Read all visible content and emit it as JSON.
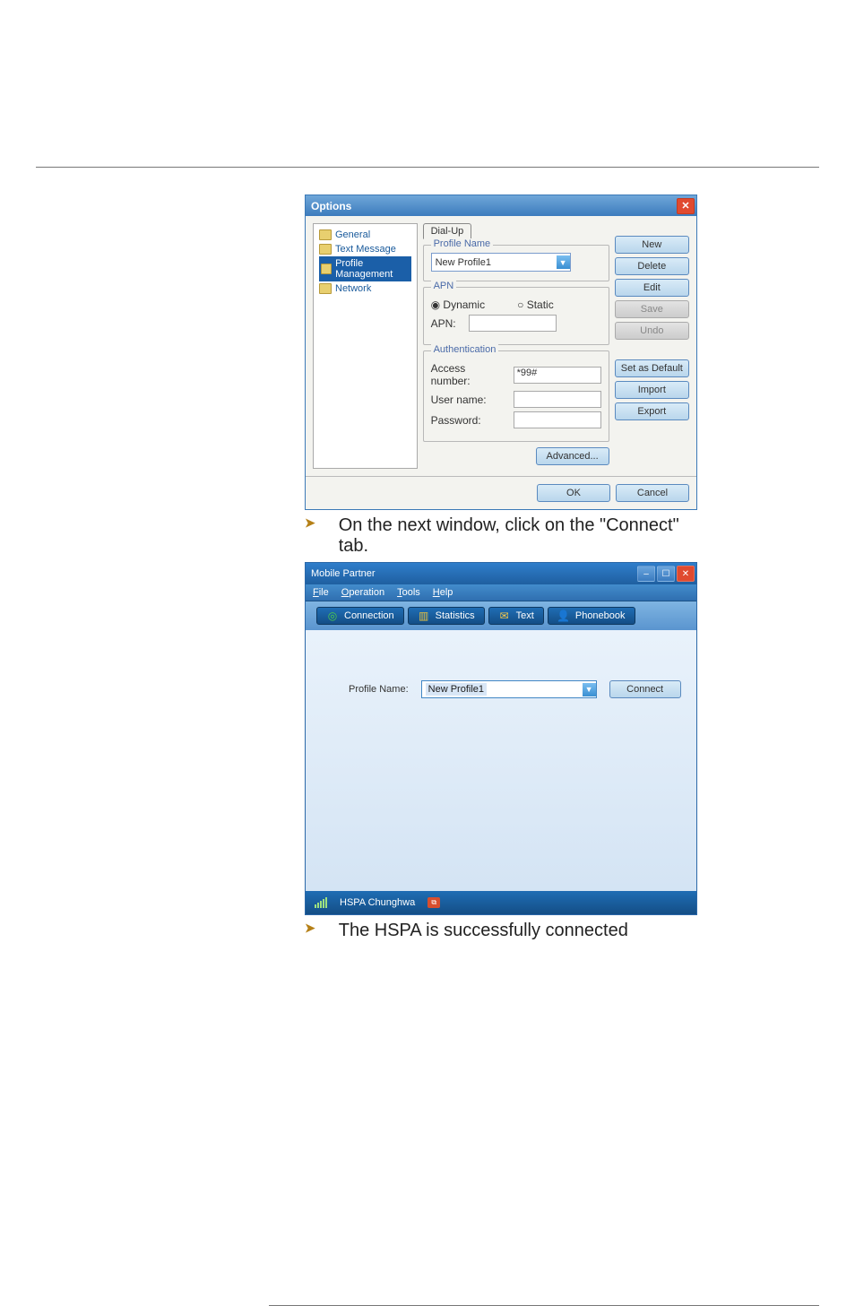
{
  "dialog1": {
    "title": "Options",
    "tree_items": [
      {
        "label": "General",
        "selected": false
      },
      {
        "label": "Text Message",
        "selected": false
      },
      {
        "label": "Profile Management",
        "selected": true
      },
      {
        "label": "Network",
        "selected": false
      }
    ],
    "tab": "Dial-Up",
    "group_profile": {
      "legend": "Profile Name",
      "value": "New  Profile1"
    },
    "group_apn": {
      "legend": "APN",
      "radio_dynamic": "Dynamic",
      "radio_static": "Static",
      "apn_label": "APN:"
    },
    "group_auth": {
      "legend": "Authentication",
      "access_label": "Access number:",
      "access_value": "*99#",
      "user_label": "User name:",
      "pass_label": "Password:"
    },
    "advanced_btn": "Advanced...",
    "buttons": {
      "new": "New",
      "delete": "Delete",
      "edit": "Edit",
      "save": "Save",
      "undo": "Undo",
      "set_default": "Set as Default",
      "import": "Import",
      "export": "Export"
    },
    "ok": "OK",
    "cancel": "Cancel"
  },
  "bullet1": "On the next window, click on the \"Connect\" tab.",
  "dialog2": {
    "title": "Mobile Partner",
    "menu": {
      "file": "File",
      "operation": "Operation",
      "tools": "Tools",
      "help": "Help"
    },
    "toolbar": {
      "connection": "Connection",
      "statistics": "Statistics",
      "text": "Text",
      "phonebook": "Phonebook"
    },
    "profile_label": "Profile Name:",
    "profile_value": "New Profile1",
    "connect": "Connect",
    "status": {
      "signal": "signal",
      "operator": "HSPA  Chunghwa",
      "net_icon": "net-disconnected"
    }
  },
  "bullet2": "The HSPA is successfully connected"
}
